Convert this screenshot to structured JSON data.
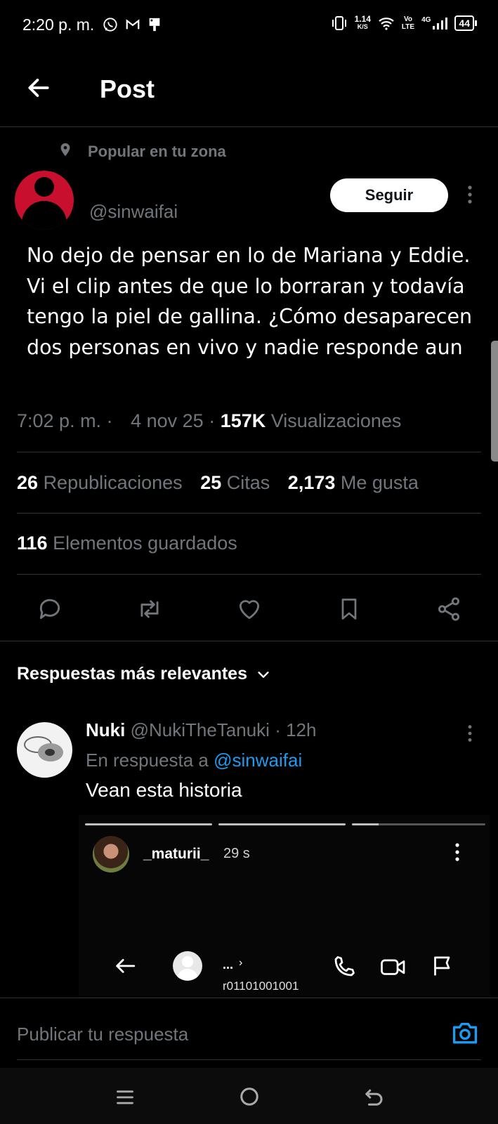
{
  "status_bar": {
    "time": "2:20 p. m.",
    "net_speed": "1.14",
    "net_unit": "K/S",
    "vo": "Vo",
    "lte": "LTE",
    "network": "4G",
    "battery": "44"
  },
  "header": {
    "back_icon": "arrow-left-icon",
    "title": "Post"
  },
  "post": {
    "social_context": "Popular en tu zona",
    "handle": "@sinwaifai",
    "follow_label": "Seguir",
    "text": "No dejo de pensar en lo de Mariana y Eddie. Vi el clip antes de que lo borraran y todavía tengo la piel de gallina. ¿Cómo desaparecen dos personas en vivo y nadie responde aun",
    "time": "7:02 p. m.",
    "date": "4 nov 25",
    "views_count": "157K",
    "views_label": "Visualizaciones",
    "reposts_count": "26",
    "reposts_label": "Republicaciones",
    "quotes_count": "25",
    "quotes_label": "Citas",
    "likes_count": "2,173",
    "likes_label": "Me gusta",
    "bookmarks_count": "116",
    "bookmarks_label": "Elementos guardados"
  },
  "actions": [
    "reply-icon",
    "repost-icon",
    "like-icon",
    "bookmark-icon",
    "share-icon"
  ],
  "replies_header": "Respuestas más relevantes",
  "reply": {
    "name": "Nuki",
    "handle": "@NukiTheTanuki",
    "time": "12h",
    "in_reply_to_label": "En respuesta a",
    "in_reply_to_handle": "@sinwaifai",
    "text": "Vean esta historia",
    "media": {
      "story_user": "_maturii_",
      "story_time": "29 s",
      "contact_name": "...",
      "contact_id": "r01101001001"
    }
  },
  "compose_placeholder": "Publicar tu respuesta",
  "colors": {
    "background": "#000000",
    "text": "#e7e9ea",
    "muted": "#71767b",
    "accent": "#1d9bf0",
    "avatar_red": "#c8102e"
  }
}
